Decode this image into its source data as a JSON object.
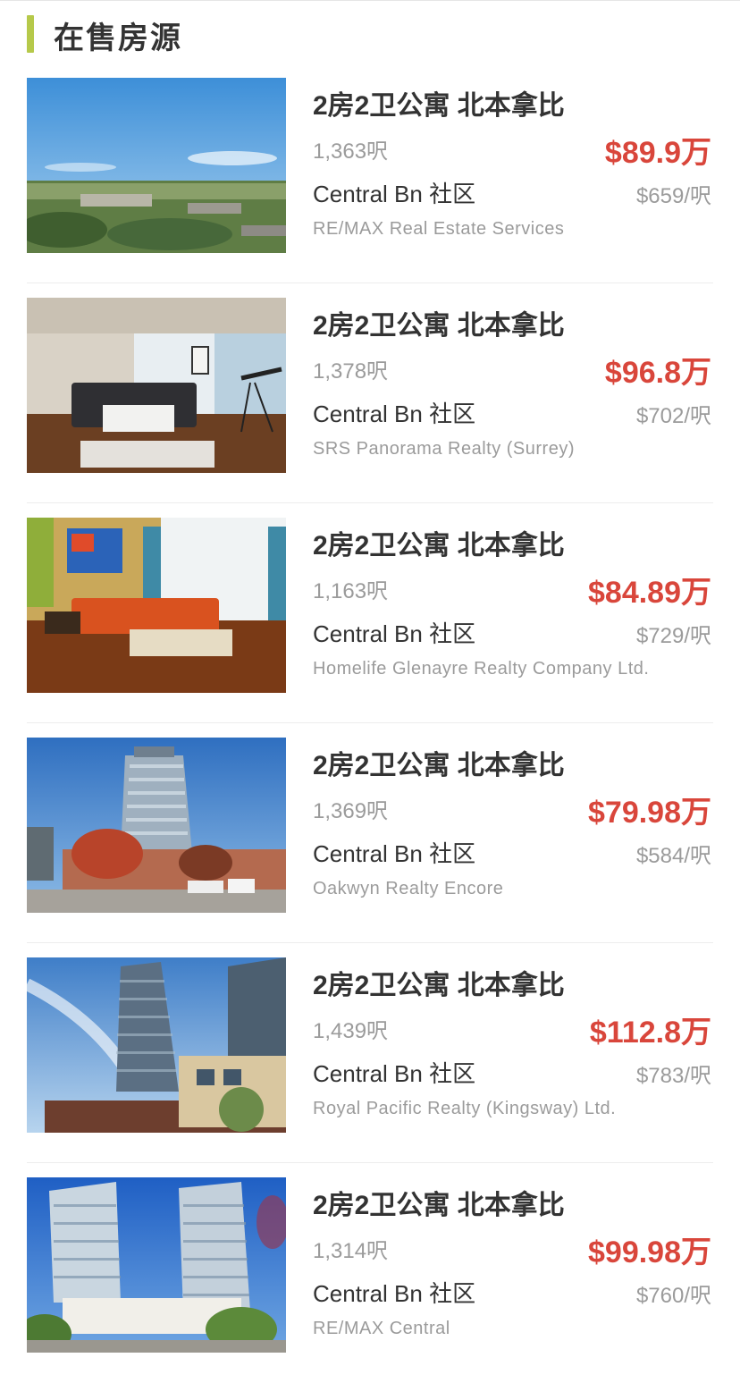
{
  "section": {
    "title": "在售房源",
    "accent_color": "#b6c94a"
  },
  "listings": [
    {
      "name": "2房2卫公寓 北本拿比",
      "area": "1,363呎",
      "price": "$89.9万",
      "community": "Central Bn 社区",
      "price_per_sqft": "$659/呎",
      "agency": "RE/MAX Real Estate Services"
    },
    {
      "name": "2房2卫公寓 北本拿比",
      "area": "1,378呎",
      "price": "$96.8万",
      "community": "Central Bn 社区",
      "price_per_sqft": "$702/呎",
      "agency": "SRS Panorama Realty (Surrey)"
    },
    {
      "name": "2房2卫公寓 北本拿比",
      "area": "1,163呎",
      "price": "$84.89万",
      "community": "Central Bn 社区",
      "price_per_sqft": "$729/呎",
      "agency": "Homelife Glenayre Realty Company Ltd."
    },
    {
      "name": "2房2卫公寓 北本拿比",
      "area": "1,369呎",
      "price": "$79.98万",
      "community": "Central Bn 社区",
      "price_per_sqft": "$584/呎",
      "agency": "Oakwyn Realty Encore"
    },
    {
      "name": "2房2卫公寓 北本拿比",
      "area": "1,439呎",
      "price": "$112.8万",
      "community": "Central Bn 社区",
      "price_per_sqft": "$783/呎",
      "agency": "Royal Pacific Realty (Kingsway) Ltd."
    },
    {
      "name": "2房2卫公寓 北本拿比",
      "area": "1,314呎",
      "price": "$99.98万",
      "community": "Central Bn 社区",
      "price_per_sqft": "$760/呎",
      "agency": "RE/MAX Central"
    }
  ],
  "colors": {
    "price": "#d9463b",
    "muted": "#9b9b9b",
    "text": "#333333"
  }
}
